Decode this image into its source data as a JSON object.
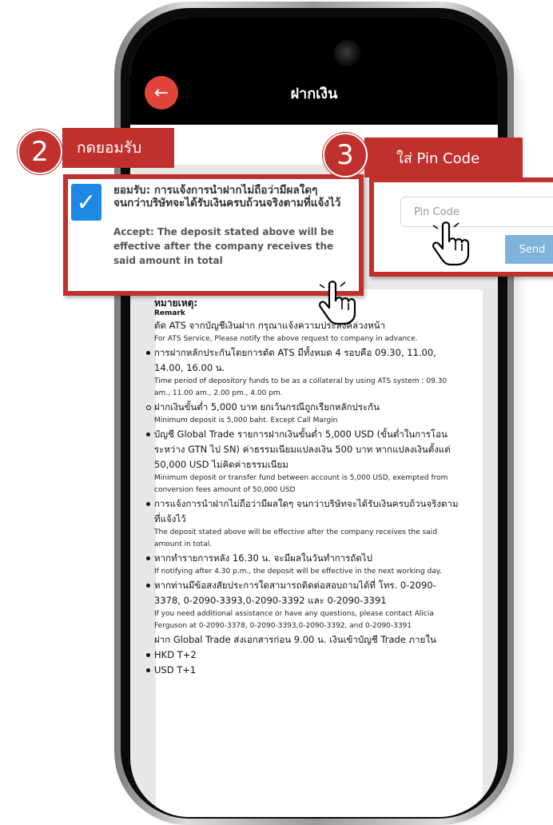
{
  "app": {
    "title": "ฝากเงิน"
  },
  "steps": {
    "accept": {
      "number": "2",
      "label": "กดยอมรับ"
    },
    "pin": {
      "number": "3",
      "label": "ใส่ Pin Code"
    }
  },
  "accept_checkbox": {
    "checked": true,
    "text_th": "ยอมรับ: การแจ้งการนำฝากไม่ถือว่ามีผลใดๆ จนกว่าบริษัทจะได้รับเงินครบถ้วนจริงตามที่แจ้งไว้",
    "text_en": "Accept: The deposit stated above will be effective after the company receives the said amount in total"
  },
  "pin_form": {
    "placeholder": "Pin Code",
    "send_label": "Send"
  },
  "remark": {
    "title": "หมายเหตุ:",
    "subtitle": "Remark",
    "intro_th": "ตัด ATS จากบัญชีเงินฝาก กรุณาแจ้งความประสงค์ล่วงหน้า",
    "intro_en": "For ATS Service, Please notify the above request to company in advance.",
    "items": [
      {
        "th": "การฝากหลักประกันโดยการตัด ATS มีทั้งหมด 4 รอบคือ 09.30, 11.00, 14.00, 16.00 น.",
        "en": "Time period of depository funds to be as a collateral by using ATS system : 09.30 am., 11.00 am., 2.00 pm., 4.00 pm."
      },
      {
        "th": "ฝากเงินขั้นต่ำ 5,000 บาท ยกเว้นกรณีถูกเรียกหลักประกัน",
        "en": "Minimum deposit is 5,000 baht. Except Call Margin"
      },
      {
        "th": "บัญชี Global Trade รายการฝากเงินขั้นต่ำ 5,000 USD (ขั้นต่ำในการโอนระหว่าง GTN ไป SN) ค่าธรรมเนียมแปลงเงิน 500 บาท หากแปลงเงินตั้งแต่ 50,000 USD ไม่คิดค่าธรรมเนียม",
        "en": "Minimum deposit or transfer fund between account is 5,000 USD, exempted from conversion fees amount of 50,000 USD"
      },
      {
        "th": "การแจ้งการนำฝากไม่ถือว่ามีผลใดๆ จนกว่าบริษัทจะได้รับเงินครบถ้วนจริงตามที่แจ้งไว้",
        "en": "The deposit stated above will be effective after the company receives the said amount in total."
      },
      {
        "th": "หากทำรายการหลัง 16.30 น. จะมีผลในวันทำการถัดไป",
        "en": "If notifying after 4.30 p.m., the deposit will be effective in the next working day."
      },
      {
        "th": "หากท่านมีข้อสงสัยประการใดสามารถติดต่อสอบถามได้ที่ โทร. 0-2090-3378, 0-2090-3393,0-2090-3392 และ 0-2090-3391",
        "en": "If you need additional assistance or have any questions, please contact Alicia Ferguson at 0-2090-3378, 0-2090-3393,0-2090-3392, and 0-2090-3391"
      }
    ],
    "global_trade_note": "ฝาก Global Trade ส่งเอกสารก่อน 9.00 น. เงินเข้าบัญชี Trade ภายใน",
    "settlement": [
      "HKD T+2",
      "USD T+1"
    ]
  },
  "icons": {
    "back": "arrow-left-icon",
    "check": "check-icon",
    "pointer": "hand-pointer-icon"
  },
  "colors": {
    "accent_red": "#c0302d",
    "back_button": "#e0443a",
    "checkbox_blue": "#1e88e5",
    "send_button": "#7fb2dd"
  }
}
